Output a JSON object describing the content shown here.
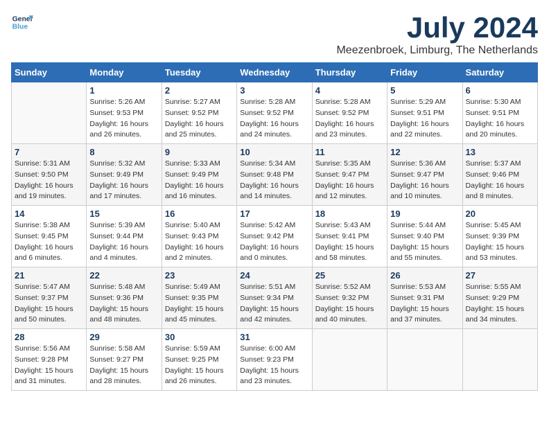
{
  "logo": {
    "line1": "General",
    "line2": "Blue"
  },
  "title": "July 2024",
  "location": "Meezenbroek, Limburg, The Netherlands",
  "weekdays": [
    "Sunday",
    "Monday",
    "Tuesday",
    "Wednesday",
    "Thursday",
    "Friday",
    "Saturday"
  ],
  "weeks": [
    [
      {
        "day": "",
        "info": ""
      },
      {
        "day": "1",
        "info": "Sunrise: 5:26 AM\nSunset: 9:53 PM\nDaylight: 16 hours\nand 26 minutes."
      },
      {
        "day": "2",
        "info": "Sunrise: 5:27 AM\nSunset: 9:52 PM\nDaylight: 16 hours\nand 25 minutes."
      },
      {
        "day": "3",
        "info": "Sunrise: 5:28 AM\nSunset: 9:52 PM\nDaylight: 16 hours\nand 24 minutes."
      },
      {
        "day": "4",
        "info": "Sunrise: 5:28 AM\nSunset: 9:52 PM\nDaylight: 16 hours\nand 23 minutes."
      },
      {
        "day": "5",
        "info": "Sunrise: 5:29 AM\nSunset: 9:51 PM\nDaylight: 16 hours\nand 22 minutes."
      },
      {
        "day": "6",
        "info": "Sunrise: 5:30 AM\nSunset: 9:51 PM\nDaylight: 16 hours\nand 20 minutes."
      }
    ],
    [
      {
        "day": "7",
        "info": "Sunrise: 5:31 AM\nSunset: 9:50 PM\nDaylight: 16 hours\nand 19 minutes."
      },
      {
        "day": "8",
        "info": "Sunrise: 5:32 AM\nSunset: 9:49 PM\nDaylight: 16 hours\nand 17 minutes."
      },
      {
        "day": "9",
        "info": "Sunrise: 5:33 AM\nSunset: 9:49 PM\nDaylight: 16 hours\nand 16 minutes."
      },
      {
        "day": "10",
        "info": "Sunrise: 5:34 AM\nSunset: 9:48 PM\nDaylight: 16 hours\nand 14 minutes."
      },
      {
        "day": "11",
        "info": "Sunrise: 5:35 AM\nSunset: 9:47 PM\nDaylight: 16 hours\nand 12 minutes."
      },
      {
        "day": "12",
        "info": "Sunrise: 5:36 AM\nSunset: 9:47 PM\nDaylight: 16 hours\nand 10 minutes."
      },
      {
        "day": "13",
        "info": "Sunrise: 5:37 AM\nSunset: 9:46 PM\nDaylight: 16 hours\nand 8 minutes."
      }
    ],
    [
      {
        "day": "14",
        "info": "Sunrise: 5:38 AM\nSunset: 9:45 PM\nDaylight: 16 hours\nand 6 minutes."
      },
      {
        "day": "15",
        "info": "Sunrise: 5:39 AM\nSunset: 9:44 PM\nDaylight: 16 hours\nand 4 minutes."
      },
      {
        "day": "16",
        "info": "Sunrise: 5:40 AM\nSunset: 9:43 PM\nDaylight: 16 hours\nand 2 minutes."
      },
      {
        "day": "17",
        "info": "Sunrise: 5:42 AM\nSunset: 9:42 PM\nDaylight: 16 hours\nand 0 minutes."
      },
      {
        "day": "18",
        "info": "Sunrise: 5:43 AM\nSunset: 9:41 PM\nDaylight: 15 hours\nand 58 minutes."
      },
      {
        "day": "19",
        "info": "Sunrise: 5:44 AM\nSunset: 9:40 PM\nDaylight: 15 hours\nand 55 minutes."
      },
      {
        "day": "20",
        "info": "Sunrise: 5:45 AM\nSunset: 9:39 PM\nDaylight: 15 hours\nand 53 minutes."
      }
    ],
    [
      {
        "day": "21",
        "info": "Sunrise: 5:47 AM\nSunset: 9:37 PM\nDaylight: 15 hours\nand 50 minutes."
      },
      {
        "day": "22",
        "info": "Sunrise: 5:48 AM\nSunset: 9:36 PM\nDaylight: 15 hours\nand 48 minutes."
      },
      {
        "day": "23",
        "info": "Sunrise: 5:49 AM\nSunset: 9:35 PM\nDaylight: 15 hours\nand 45 minutes."
      },
      {
        "day": "24",
        "info": "Sunrise: 5:51 AM\nSunset: 9:34 PM\nDaylight: 15 hours\nand 42 minutes."
      },
      {
        "day": "25",
        "info": "Sunrise: 5:52 AM\nSunset: 9:32 PM\nDaylight: 15 hours\nand 40 minutes."
      },
      {
        "day": "26",
        "info": "Sunrise: 5:53 AM\nSunset: 9:31 PM\nDaylight: 15 hours\nand 37 minutes."
      },
      {
        "day": "27",
        "info": "Sunrise: 5:55 AM\nSunset: 9:29 PM\nDaylight: 15 hours\nand 34 minutes."
      }
    ],
    [
      {
        "day": "28",
        "info": "Sunrise: 5:56 AM\nSunset: 9:28 PM\nDaylight: 15 hours\nand 31 minutes."
      },
      {
        "day": "29",
        "info": "Sunrise: 5:58 AM\nSunset: 9:27 PM\nDaylight: 15 hours\nand 28 minutes."
      },
      {
        "day": "30",
        "info": "Sunrise: 5:59 AM\nSunset: 9:25 PM\nDaylight: 15 hours\nand 26 minutes."
      },
      {
        "day": "31",
        "info": "Sunrise: 6:00 AM\nSunset: 9:23 PM\nDaylight: 15 hours\nand 23 minutes."
      },
      {
        "day": "",
        "info": ""
      },
      {
        "day": "",
        "info": ""
      },
      {
        "day": "",
        "info": ""
      }
    ]
  ]
}
